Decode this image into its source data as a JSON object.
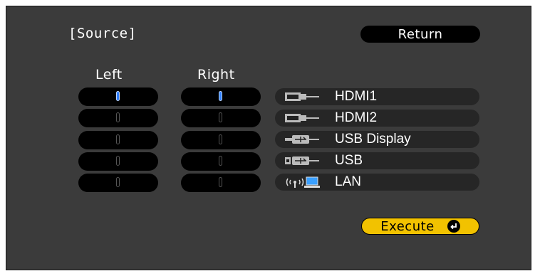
{
  "title": "[Source]",
  "return_label": "Return",
  "columns": {
    "left": "Left",
    "right": "Right"
  },
  "selection": {
    "left": "HDMI1",
    "right": "HDMI1"
  },
  "sources": [
    {
      "label": "HDMI1",
      "icon": "hdmi-icon"
    },
    {
      "label": "HDMI2",
      "icon": "hdmi-icon"
    },
    {
      "label": "USB Display",
      "icon": "usb-display-icon"
    },
    {
      "label": "USB",
      "icon": "usb-icon"
    },
    {
      "label": "LAN",
      "icon": "lan-icon"
    }
  ],
  "execute_label": "Execute",
  "colors": {
    "background": "#3b3b3b",
    "selected": "#2f7fff",
    "execute": "#f2c200"
  }
}
